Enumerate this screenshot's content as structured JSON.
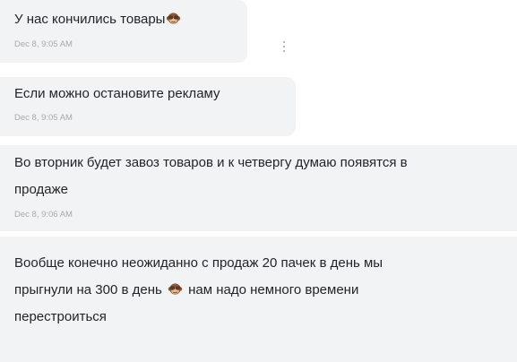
{
  "messages": [
    {
      "text": "У нас кончились товары",
      "emoji": "see-no-evil-monkey",
      "time": "Dec 8, 9:05 AM"
    },
    {
      "text": "Если можно остановите рекламу",
      "time": "Dec 8, 9:05 AM"
    },
    {
      "line1": "Во вторник будет завоз товаров и к четвергу думаю появятся в",
      "line2": "продаже",
      "time": "Dec 8, 9:06 AM"
    },
    {
      "line1": "Вообще конечно неожиданно с продаж 20 пачек в день мы",
      "line2_before": "прыгнули на 300 в день",
      "emoji": "see-no-evil-monkey",
      "line2_after": "нам надо немного времени",
      "line3": "перестроиться"
    }
  ],
  "colors": {
    "bubble_bg": "#f2f3f5",
    "text": "#1f2328",
    "timestamp": "#a7aab0"
  },
  "icons": {
    "message_menu": "vertical-ellipsis-icon",
    "emoji": "see-no-evil-monkey-emoji-icon"
  }
}
